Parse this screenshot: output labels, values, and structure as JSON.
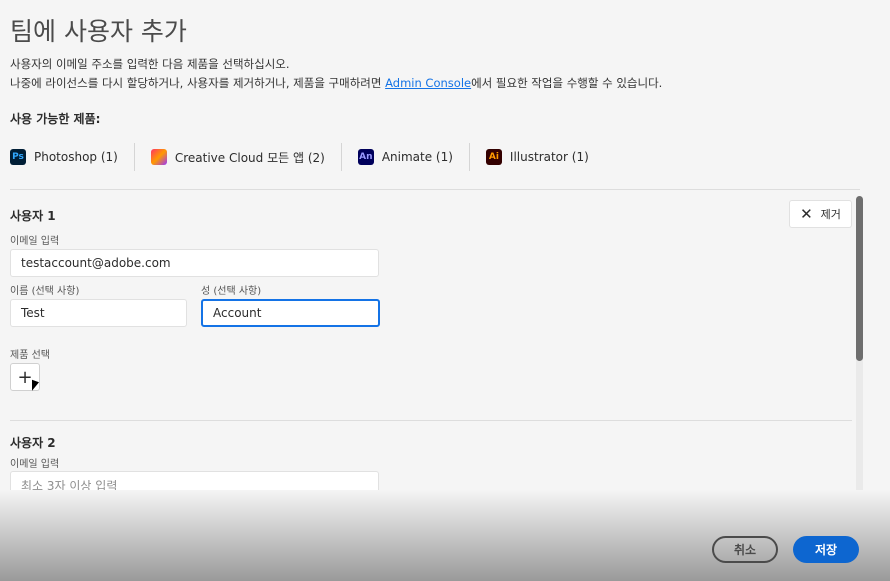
{
  "title": "팀에 사용자 추가",
  "description": {
    "line1": "사용자의 이메일 주소를 입력한 다음 제품을 선택하십시오.",
    "line2_pre": "나중에 라이선스를 다시 할당하거나, 사용자를 제거하거나, 제품을 구매하려면 ",
    "link": "Admin Console",
    "line2_post": "에서 필요한 작업을 수행할 수 있습니다."
  },
  "available_label": "사용 가능한 제품:",
  "products": [
    {
      "icon": "Ps",
      "label": "Photoshop (1)",
      "color": "#001e36",
      "text_color": "#31a8ff"
    },
    {
      "icon": "cc",
      "label": "Creative Cloud 모든 앱 (2)",
      "color": "#ff3366",
      "text_color": "#fff"
    },
    {
      "icon": "An",
      "label": "Animate (1)",
      "color": "#00005b",
      "text_color": "#9999ff"
    },
    {
      "icon": "Ai",
      "label": "Illustrator (1)",
      "color": "#330000",
      "text_color": "#ff9a00"
    }
  ],
  "user1": {
    "title": "사용자 1",
    "remove": "제거",
    "email_label": "이메일 입력",
    "email": "testaccount@adobe.com",
    "first_label": "이름 (선택 사항)",
    "first": "Test",
    "last_label": "성 (선택 사항)",
    "last": "Account",
    "product_label": "제품 선택"
  },
  "user2": {
    "title": "사용자 2",
    "email_label": "이메일 입력",
    "email_placeholder": "최소 3자 이상 입력"
  },
  "footer": {
    "cancel": "취소",
    "save": "저장"
  },
  "accent": "#0d66d0"
}
